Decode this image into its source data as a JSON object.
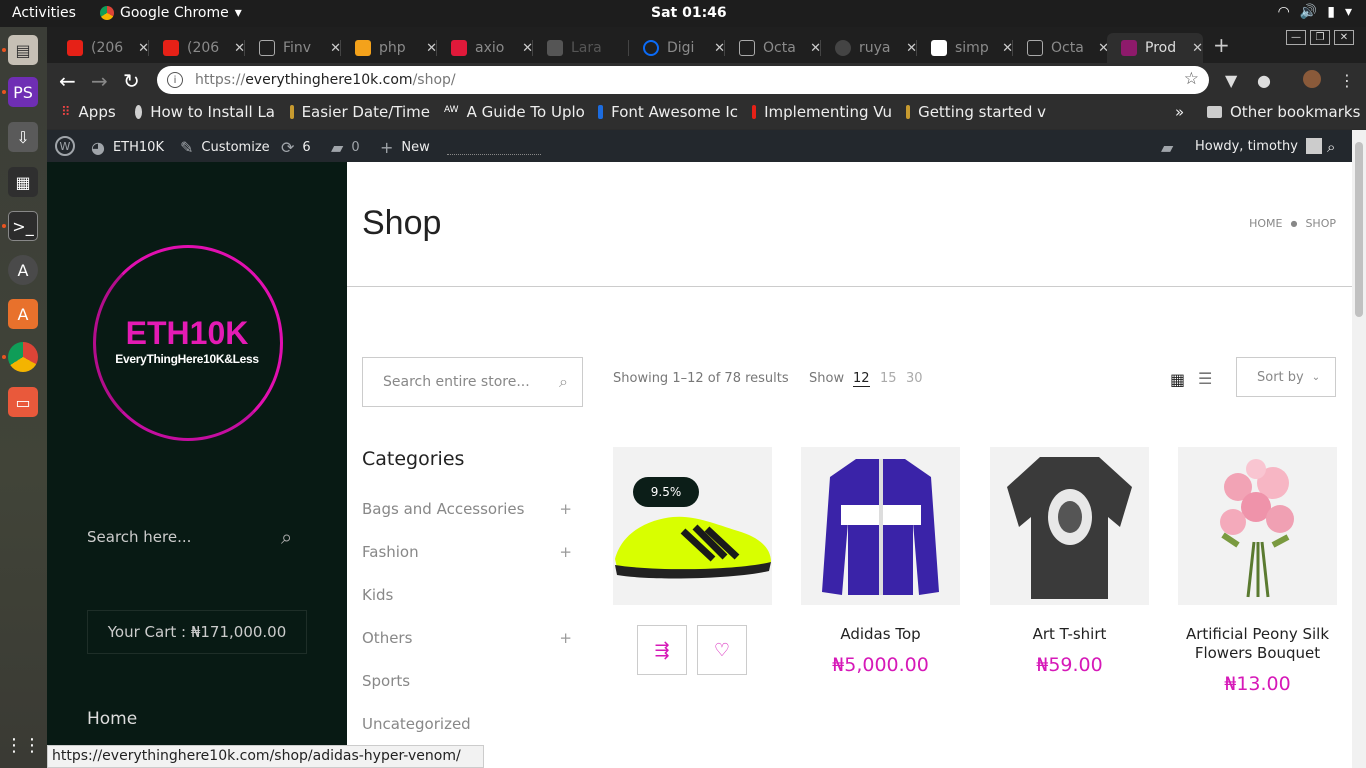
{
  "topbar": {
    "activities": "Activities",
    "app_name": "Google Chrome",
    "clock": "Sat 01:46"
  },
  "tabs": [
    {
      "label": "(206",
      "color": "#e62117"
    },
    {
      "label": "(206",
      "color": "#e62117"
    },
    {
      "label": "Finv",
      "color": "#9e9e9e"
    },
    {
      "label": "php",
      "color": "#f4a21b"
    },
    {
      "label": "axio",
      "color": "#e0193a"
    },
    {
      "label": "Lara",
      "color": "#666666"
    },
    {
      "label": "Digi",
      "color": "#0b6bf7"
    },
    {
      "label": "Octa",
      "color": "#9e9e9e"
    },
    {
      "label": "ruya",
      "color": "#444444"
    },
    {
      "label": "simp",
      "color": "#ffffff"
    },
    {
      "label": "Octa",
      "color": "#9e9e9e"
    },
    {
      "label": "Prod",
      "color": "#8e1a6b"
    }
  ],
  "address": {
    "scheme": "https://",
    "host": "everythinghere10k.com",
    "path": "/shop/"
  },
  "bookmarks": [
    {
      "label": "Apps",
      "color": "#4285f4"
    },
    {
      "label": "How to Install La",
      "color": "#d0d0d0"
    },
    {
      "label": "Easier Date/Time",
      "color": "#c79a2f"
    },
    {
      "label": "A Guide To Uploa",
      "color": "#333333"
    },
    {
      "label": "Font Awesome Ic",
      "color": "#1c6ce0"
    },
    {
      "label": "Implementing Vu",
      "color": "#e62117"
    },
    {
      "label": "Getting started v",
      "color": "#c79a2f"
    }
  ],
  "bookmarks_more": "»",
  "other_bookmarks": "Other bookmarks",
  "wpadmin": {
    "site": "ETH10K",
    "customize": "Customize",
    "updates": "6",
    "comments": "0",
    "new": "New",
    "howdy": "Howdy, timothy"
  },
  "sidebar": {
    "logo_main": "ETH10K",
    "logo_sub": "EveryThingHere10K&Less",
    "search_placeholder": "Search here...",
    "cart": "Your Cart : ₦171,000.00",
    "home": "Home"
  },
  "main": {
    "title": "Shop",
    "breadcrumb": [
      "HOME",
      "SHOP"
    ],
    "search_placeholder": "Search entire store...",
    "showing": "Showing 1–12 of 78 results",
    "show_label": "Show",
    "per_page": [
      "12",
      "15",
      "30"
    ],
    "sort_label": "Sort by",
    "categories_title": "Categories",
    "categories": [
      {
        "label": "Bags and Accessories",
        "expand": "+"
      },
      {
        "label": "Fashion",
        "expand": "+"
      },
      {
        "label": "Kids",
        "expand": ""
      },
      {
        "label": "Others",
        "expand": "+"
      },
      {
        "label": "Sports",
        "expand": ""
      },
      {
        "label": "Uncategorized",
        "expand": ""
      }
    ],
    "products": [
      {
        "name": "",
        "price": "",
        "badge": "9.5%"
      },
      {
        "name": "Adidas Top",
        "price": "₦5,000.00"
      },
      {
        "name": "Art T-shirt",
        "price": "₦59.00"
      },
      {
        "name": "Artificial Peony Silk Flowers Bouquet",
        "price": "₦13.00"
      }
    ]
  },
  "status_url": "https://everythinghere10k.com/shop/adidas-hyper-venom/",
  "colors": {
    "accent": "#d619b8",
    "sidebar_bg": "#081a14",
    "wp_bar": "#23282d"
  }
}
